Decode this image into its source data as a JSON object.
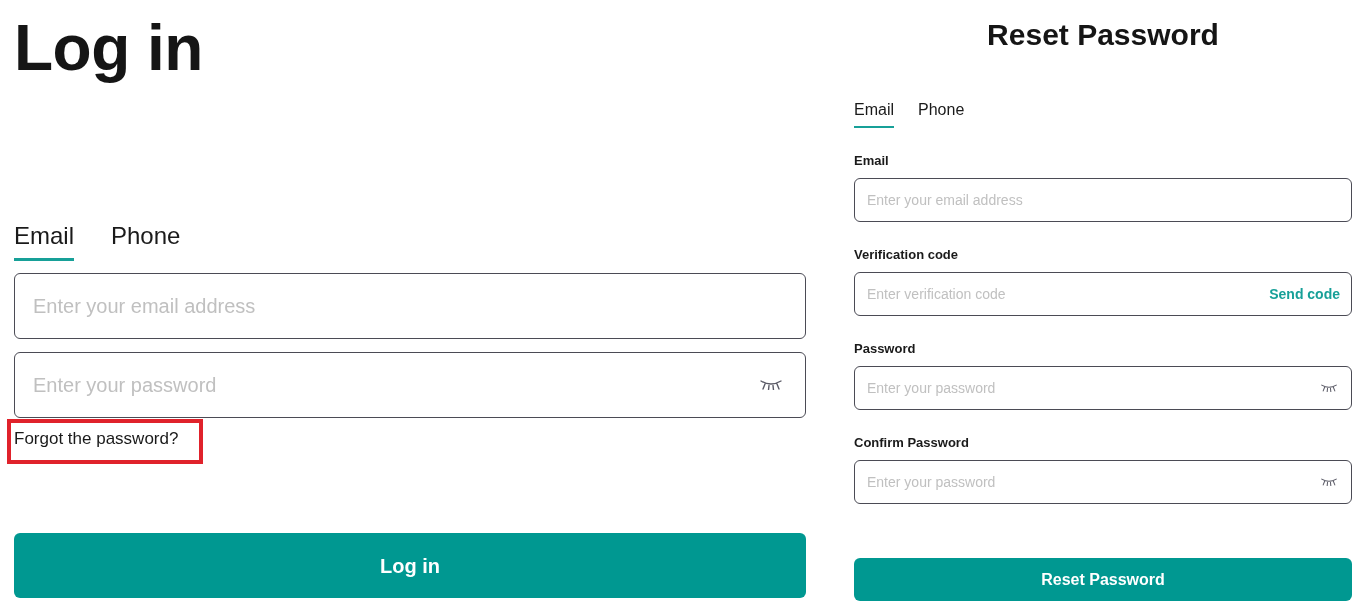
{
  "login": {
    "title": "Log in",
    "tabs": [
      {
        "label": "Email",
        "selected": true
      },
      {
        "label": "Phone",
        "selected": false
      }
    ],
    "fields": [
      {
        "kind": "text",
        "placeholder": "Enter your email address"
      },
      {
        "kind": "password",
        "placeholder": "Enter your password"
      }
    ],
    "forgot_link": {
      "label": "Forgot the password?",
      "highlighted": true
    },
    "submit": "Log in"
  },
  "reset": {
    "title": "Reset Password",
    "tabs": [
      {
        "label": "Email",
        "selected": true
      },
      {
        "label": "Phone",
        "selected": false
      }
    ],
    "fields": [
      {
        "kind": "text",
        "label": "Email",
        "placeholder": "Enter your email address"
      },
      {
        "kind": "code",
        "label": "Verification code",
        "placeholder": "Enter verification code",
        "action": "Send code"
      },
      {
        "kind": "password",
        "label": "Password",
        "placeholder": "Enter your password"
      },
      {
        "kind": "password",
        "label": "Confirm Password",
        "placeholder": "Enter your password"
      }
    ],
    "submit": "Reset Password"
  }
}
